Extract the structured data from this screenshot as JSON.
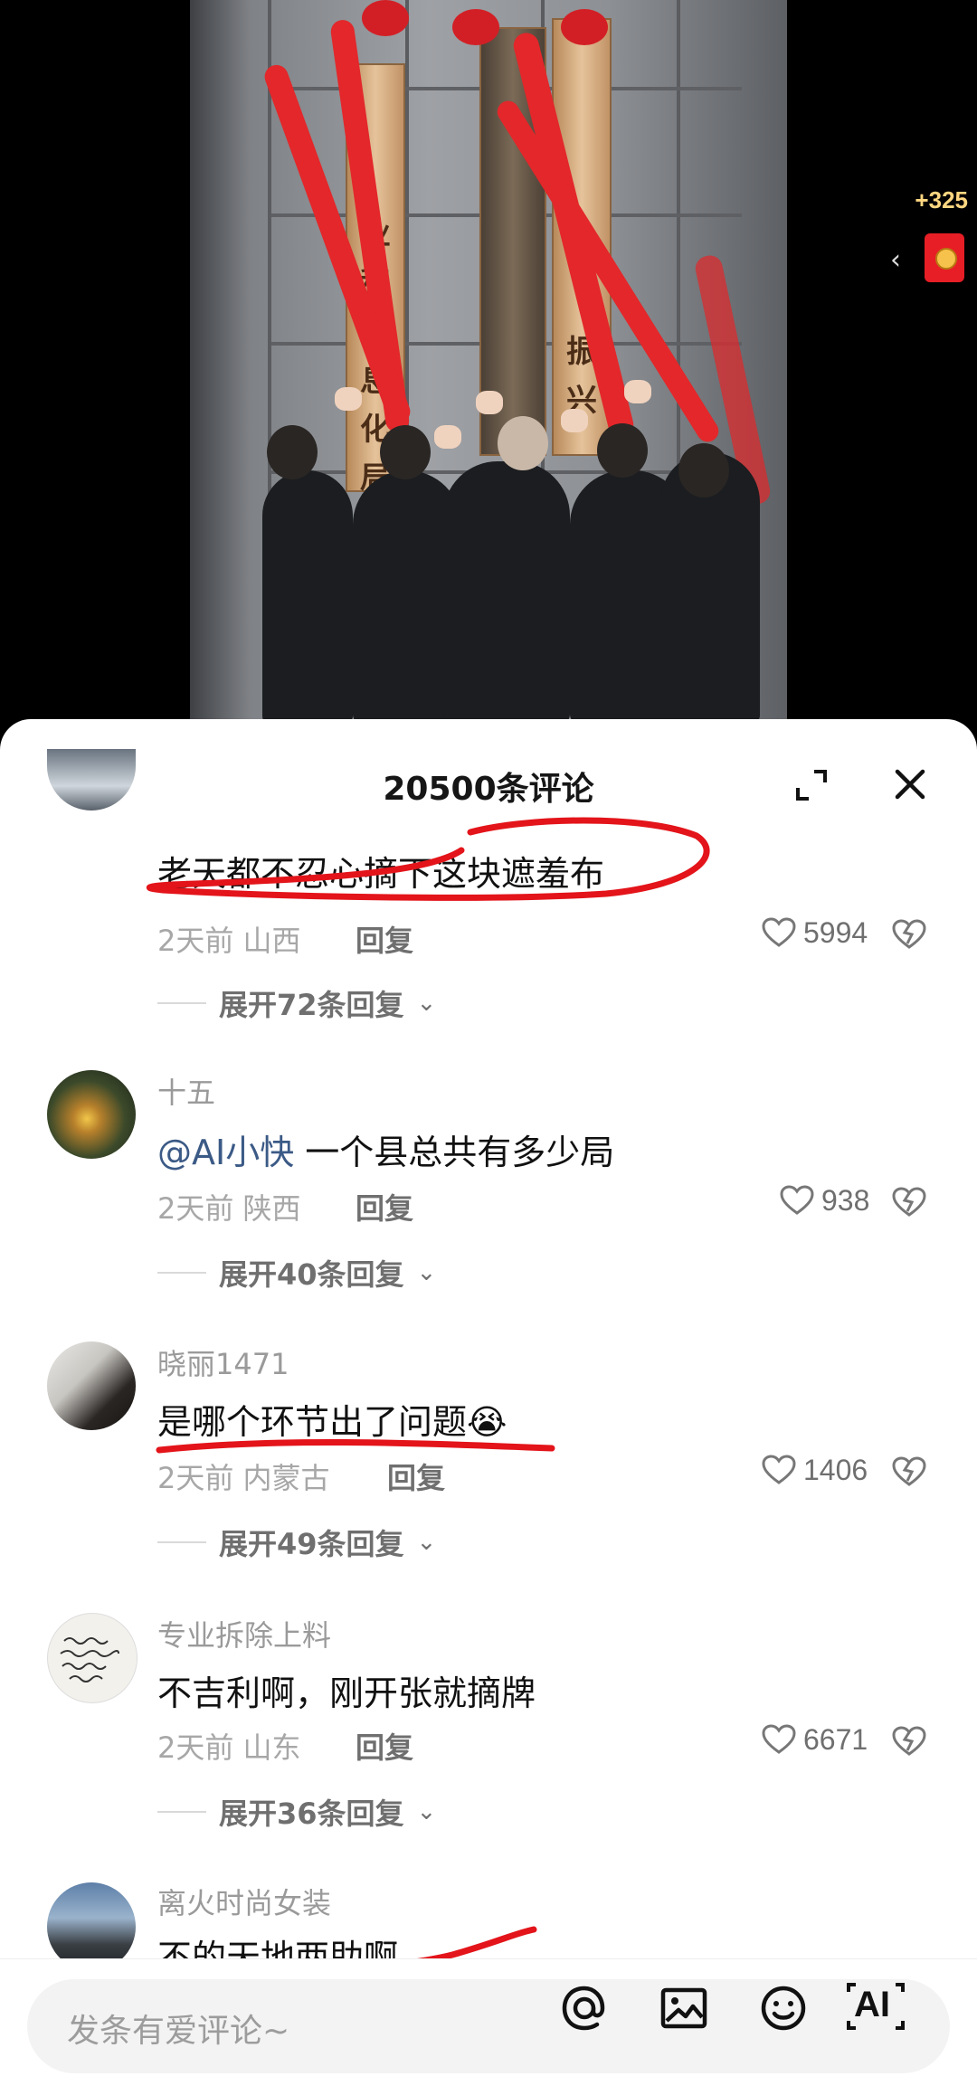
{
  "red_packet": {
    "count": "+325"
  },
  "video": {
    "plaque_left_text": [
      "业",
      "和",
      "信",
      "息",
      "化",
      "局"
    ],
    "plaque_right_text": [
      "振",
      "兴"
    ]
  },
  "sheet": {
    "title": "20500条评论",
    "comments": [
      {
        "user": "",
        "text": "老天都不忍心摘下这块遮羞布",
        "time": "2天前",
        "region": "山西",
        "reply_label": "回复",
        "likes": "5994",
        "expand_label": "展开72条回复"
      },
      {
        "user": "十五",
        "mention": "@AI小快",
        "text": " 一个县总共有多少局",
        "time": "2天前",
        "region": "陕西",
        "reply_label": "回复",
        "likes": "938",
        "expand_label": "展开40条回复"
      },
      {
        "user": "晓丽1471",
        "text": "是哪个环节出了问题😭",
        "time": "2天前",
        "region": "内蒙古",
        "reply_label": "回复",
        "likes": "1406",
        "expand_label": "展开49条回复"
      },
      {
        "user": "专业拆除上料",
        "text": "不吉利啊，刚开张就摘牌",
        "time": "2天前",
        "region": "山东",
        "reply_label": "回复",
        "likes": "6671",
        "expand_label": "展开36条回复"
      },
      {
        "user": "离火时尚女装",
        "text": "不的天地两助啊"
      }
    ]
  },
  "input": {
    "placeholder": "发条有爱评论~",
    "ai_label": "AI"
  },
  "colors": {
    "annotation": "#e3141a",
    "mention": "#3b5a86"
  }
}
